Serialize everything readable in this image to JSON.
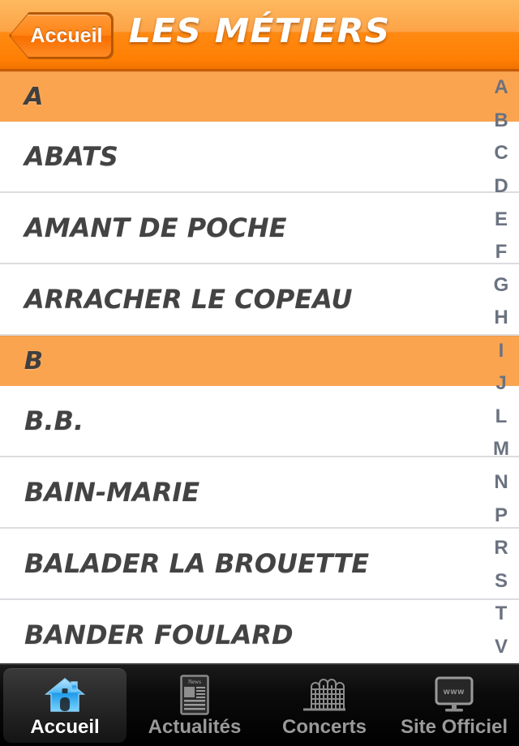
{
  "navbar": {
    "back_label": "Accueil",
    "title": "LES MÉTIERS",
    "gradient_top": "#fdb95f",
    "gradient_bottom": "#ff7f04"
  },
  "list": {
    "section_header_color": "#fba450",
    "row_text_color": "#434343",
    "separator_color": "#dddde0",
    "sections": [
      {
        "letter": "A",
        "items": [
          {
            "label": "ABATS"
          },
          {
            "label": "AMANT DE POCHE"
          },
          {
            "label": "ARRACHER LE COPEAU"
          }
        ]
      },
      {
        "letter": "B",
        "items": [
          {
            "label": "B.B."
          },
          {
            "label": "BAIN-MARIE"
          },
          {
            "label": "BALADER LA BROUETTE"
          },
          {
            "label": "BANDER FOULARD"
          }
        ]
      }
    ]
  },
  "index_bar": {
    "text_color": "#6b7280",
    "letters": [
      "A",
      "B",
      "C",
      "D",
      "E",
      "F",
      "G",
      "H",
      "I",
      "J",
      "L",
      "M",
      "N",
      "P",
      "R",
      "S",
      "T",
      "V"
    ]
  },
  "tabbar": {
    "active_index": 0,
    "tabs": [
      {
        "label": "Accueil",
        "icon": "home-icon"
      },
      {
        "label": "Actualités",
        "icon": "newspaper-icon"
      },
      {
        "label": "Concerts",
        "icon": "stadium-icon"
      },
      {
        "label": "Site Officiel",
        "icon": "monitor-www-icon"
      }
    ]
  }
}
